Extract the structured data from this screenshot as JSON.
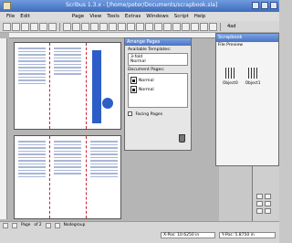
{
  "window": {
    "title": "Scribus 1.3.x - [/home/peter/Documents/scrapbook.sla]"
  },
  "menubar": {
    "items": [
      "File",
      "Edit",
      "Page",
      "View",
      "Tools",
      "Extras",
      "Windows",
      "Script",
      "Help"
    ]
  },
  "toolbar": {
    "zoom_label": "4ad"
  },
  "arrange_pages": {
    "title": "Arrange Pages",
    "templates_label": "Available Templates:",
    "templates": [
      "3-fold",
      "Normal"
    ],
    "doc_pages_label": "Document Pages:",
    "doc_pages": [
      "Normal",
      "Normal"
    ],
    "facing_pages_label": "Facing Pages"
  },
  "scrapbook": {
    "title": "Scrapbook",
    "menu_label": "File  Preview",
    "objects": [
      "Object0",
      "Object1"
    ]
  },
  "statusbar": {
    "page_label": "Page",
    "page_of": "of 2",
    "layer_label": "Nodegroup"
  },
  "position": {
    "xpos_label": "X-Pos: 10.6250 in",
    "ypos_label": "Y-Pos: 5.8750 in"
  },
  "colors": {
    "accent": "#2d5ec7",
    "titlebar": "#4a74c2"
  }
}
